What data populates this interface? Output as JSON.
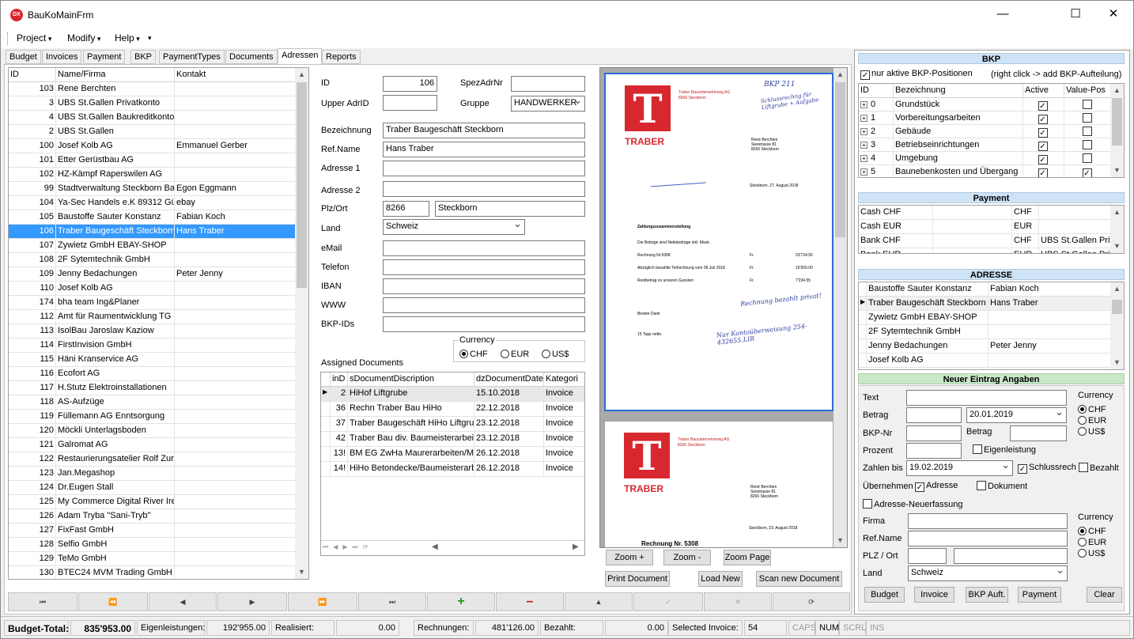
{
  "window": {
    "title": "BauKoMainFrm",
    "icon_text": "DX"
  },
  "menu": {
    "project": "Project",
    "modify": "Modify",
    "help": "Help"
  },
  "tabs": [
    "Budget",
    "Invoices",
    "Payment",
    "BKP",
    "PaymentTypes",
    "Documents",
    "Adressen",
    "Reports"
  ],
  "addr_grid": {
    "headers": [
      "ID",
      "Name/Firma",
      "Kontakt"
    ],
    "rows": [
      [
        "103",
        "Rene Berchten",
        ""
      ],
      [
        "3",
        "UBS St.Gallen Privatkonto",
        ""
      ],
      [
        "4",
        "UBS St.Gallen Baukreditkonto",
        ""
      ],
      [
        "2",
        "UBS St.Gallen",
        ""
      ],
      [
        "100",
        "Josef Kolb AG",
        "Emmanuel Gerber"
      ],
      [
        "101",
        "Etter Gerüstbau AG",
        ""
      ],
      [
        "102",
        "HZ-Kämpf Raperswilen AG",
        ""
      ],
      [
        "99",
        "Stadtverwaltung Steckborn Ba",
        "Egon Eggmann"
      ],
      [
        "104",
        "Ya-Sec Handels e.K 89312 Gür",
        "ebay"
      ],
      [
        "105",
        "Baustoffe Sauter Konstanz",
        "Fabian Koch"
      ],
      [
        "106",
        "Traber Baugeschäft Steckborn",
        "Hans Traber"
      ],
      [
        "107",
        "Zywietz GmbH EBAY-SHOP",
        ""
      ],
      [
        "108",
        "2F Sytemtechnik GmbH",
        ""
      ],
      [
        "109",
        "Jenny Bedachungen",
        "Peter Jenny"
      ],
      [
        "110",
        "Josef Kolb AG",
        ""
      ],
      [
        "174",
        "bha team Ing&Planer",
        ""
      ],
      [
        "112",
        "Amt für Raumentwicklung TG",
        ""
      ],
      [
        "113",
        "IsolBau Jaroslaw Kaziow",
        ""
      ],
      [
        "114",
        "FirstInvision GmbH",
        ""
      ],
      [
        "115",
        "Häni Kranservice AG",
        ""
      ],
      [
        "116",
        "Ecofort AG",
        ""
      ],
      [
        "117",
        "H.Stutz Elektroinstallationen",
        ""
      ],
      [
        "118",
        "AS-Aufzüge",
        ""
      ],
      [
        "119",
        "Füllemann AG Enntsorgung",
        ""
      ],
      [
        "120",
        "Möckli Unterlagsboden",
        ""
      ],
      [
        "121",
        "Galromat AG",
        ""
      ],
      [
        "122",
        "Restaurierungsatelier Rolf Zur",
        ""
      ],
      [
        "123",
        "Jan.Megashop",
        ""
      ],
      [
        "124",
        "Dr.Eugen Stall",
        ""
      ],
      [
        "125",
        "My Commerce Digital River Irel",
        ""
      ],
      [
        "126",
        "Adam Tryba \"Sani-Tryb\"",
        ""
      ],
      [
        "127",
        "FixFast GmbH",
        ""
      ],
      [
        "128",
        "Selfio GmbH",
        ""
      ],
      [
        "129",
        "TeMo GmbH",
        ""
      ],
      [
        "130",
        "BTEC24 MVM Trading GmbH",
        ""
      ]
    ]
  },
  "form": {
    "id_label": "ID",
    "id_value": "106",
    "spez_label": "SpezAdrNr",
    "spez_value": "",
    "upper_label": "Upper AdrID",
    "upper_value": "",
    "gruppe_label": "Gruppe",
    "gruppe_value": "HANDWERKER",
    "bez_label": "Bezeichnung",
    "bez_value": "Traber Baugeschäft Steckborn",
    "ref_label": "Ref.Name",
    "ref_value": "Hans Traber",
    "adr1_label": "Adresse 1",
    "adr1_value": "",
    "adr2_label": "Adresse 2",
    "adr2_value": "",
    "plz_label": "Plz/Ort",
    "plz_value": "8266",
    "ort_value": "Steckborn",
    "land_label": "Land",
    "land_value": "Schweiz",
    "email_label": "eMail",
    "email_value": "",
    "tel_label": "Telefon",
    "tel_value": "",
    "iban_label": "IBAN",
    "iban_value": "",
    "www_label": "WWW",
    "www_value": "",
    "bkp_label": "BKP-IDs",
    "bkp_value": "",
    "currency_label": "Currency",
    "cur_chf": "CHF",
    "cur_eur": "EUR",
    "cur_usd": "US$"
  },
  "assigned": {
    "label": "Assigned Documents",
    "headers": [
      "inD",
      "sDocumentDiscription",
      "dzDocumentDate",
      "Kategori"
    ],
    "rows": [
      [
        "2",
        "HiHof Liftgrube",
        "15.10.2018",
        "Invoice"
      ],
      [
        "36",
        "Rechn Traber Bau HiHo",
        "22.12.2018",
        "Invoice"
      ],
      [
        "37",
        "Traber Baugeschäft HiHo Liftgrul",
        "23.12.2018",
        "Invoice"
      ],
      [
        "42",
        "Traber Bau div. Baumeisterarbei",
        "23.12.2018",
        "Invoice"
      ],
      [
        "13!",
        "BM EG ZwHa Maurerarbeiten/Ma",
        "26.12.2018",
        "Invoice"
      ],
      [
        "14!",
        "HiHo Betondecke/Baumeisterarbe",
        "26.12.2018",
        "Invoice"
      ]
    ]
  },
  "preview": {
    "logo_letter": "T",
    "logo_name": "TRABER",
    "company": "Traber Bauunternehmung AG",
    "company_city": "8266 Steckborn",
    "recipient": "René Berchten",
    "recipient_street": "Seestrasse 81",
    "recipient_city": "8266 Steckborn",
    "date_line": "Steckborn, 27. August 2018",
    "date_line2": "Steckborn, 23. August 2018",
    "heading": "Zahlungszusammenstellung",
    "line1": "Die Beträge sind Nettobeträge inkl. Mwst.",
    "line2": "Rechnung Nr.5308",
    "line3": "Abzüglich bezahlte Teilrechnung vom 06.Juli 2018",
    "line4": "Restbetrag zu unseren Gunsten",
    "amt1": "23'734.55",
    "amt2": "16'500.00",
    "amt3": "7'234.55",
    "fr": "Fr.",
    "thanks": "Besten Dank",
    "terms": "15 Tage netto",
    "rechnung": "Rechnung Nr. 5308",
    "hand1": "BKP 211",
    "hand2": "Schlussrechng für Liftgrube + Aufgabe",
    "hand3": "Rechnung bezahlt privat!",
    "hand4": "Nur Kontoüberweisung 254-432655.LIR"
  },
  "preview_buttons": {
    "zoom_in": "Zoom +",
    "zoom_out": "Zoom -",
    "zoom_page": "Zoom Page",
    "print": "Print Document",
    "load": "Load New",
    "scan": "Scan new Document"
  },
  "bkp": {
    "title": "BKP",
    "only_active": "nur aktive BKP-Positionen",
    "hint": "(right click -> add BKP-Aufteilung)",
    "headers": [
      "ID",
      "Bezeichnung",
      "Active",
      "Value-Pos"
    ],
    "rows": [
      [
        "0",
        "Grundstück"
      ],
      [
        "1",
        "Vorbereitungsarbeiten"
      ],
      [
        "2",
        "Gebäude"
      ],
      [
        "3",
        "Betriebseinrichtungen"
      ],
      [
        "4",
        "Umgebung"
      ],
      [
        "5",
        "Baunebenkosten und Übergang"
      ]
    ]
  },
  "payment": {
    "title": "Payment",
    "rows": [
      [
        "Cash CHF",
        "CHF",
        ""
      ],
      [
        "Cash EUR",
        "EUR",
        ""
      ],
      [
        "Bank CHF",
        "CHF",
        "UBS St.Gallen Priva"
      ],
      [
        "Bank EUR",
        "EUR",
        "UBS St.Gallen Priv"
      ]
    ]
  },
  "adresse": {
    "title": "ADRESSE",
    "rows": [
      [
        "Baustoffe Sauter Konstanz",
        "Fabian Koch"
      ],
      [
        "Traber Baugeschäft Steckborn",
        "Hans Traber"
      ],
      [
        "Zywietz GmbH EBAY-SHOP",
        ""
      ],
      [
        "2F Sytemtechnik GmbH",
        ""
      ],
      [
        "Jenny Bedachungen",
        "Peter Jenny"
      ],
      [
        "Josef Kolb AG",
        ""
      ]
    ]
  },
  "neuer": {
    "title": "Neuer Eintrag Angaben",
    "text": "Text",
    "betrag": "Betrag",
    "date1": "20.01.2019",
    "bkpnr": "BKP-Nr",
    "betrag2": "Betrag",
    "prozent": "Prozent",
    "eigen": "Eigenleistung",
    "zahlen": "Zahlen bis",
    "date2": "19.02.2019",
    "schluss": "Schlussrech",
    "bezahlt": "Bezahlt",
    "uebernehmen": "Übernehmen",
    "adresse": "Adresse",
    "dokument": "Dokument",
    "neufassung": "Adresse-Neuerfassung",
    "firma": "Firma",
    "refname": "Ref.Name",
    "plzort": "PLZ / Ort",
    "land": "Land",
    "land_value": "Schweiz",
    "currency": "Currency",
    "chf": "CHF",
    "eur": "EUR",
    "usd": "US$",
    "b_budget": "Budget",
    "b_invoice": "Invoice",
    "b_bkp": "BKP Auft.",
    "b_payment": "Payment",
    "b_clear": "Clear"
  },
  "status": {
    "budget_total": "Budget-Total:",
    "budget_val": "835'953.00",
    "eigen": "Eigenleistungen:",
    "eigen_val": "192'955.00",
    "real": "Realisiert:",
    "real_val": "0.00",
    "rech": "Rechnungen:",
    "rech_val": "481'126.00",
    "bez": "Bezahlt:",
    "bez_val": "0.00",
    "selinv": "Selected Invoice:",
    "selinv_val": "54",
    "caps": "CAPS",
    "num": "NUM",
    "scrl": "SCRL",
    "ins": "INS"
  },
  "colors": {
    "selection": "#3399ff",
    "section_header": "#cfe3f7",
    "neuer_header": "#c9e7c9",
    "logo_red": "#d8282f"
  }
}
